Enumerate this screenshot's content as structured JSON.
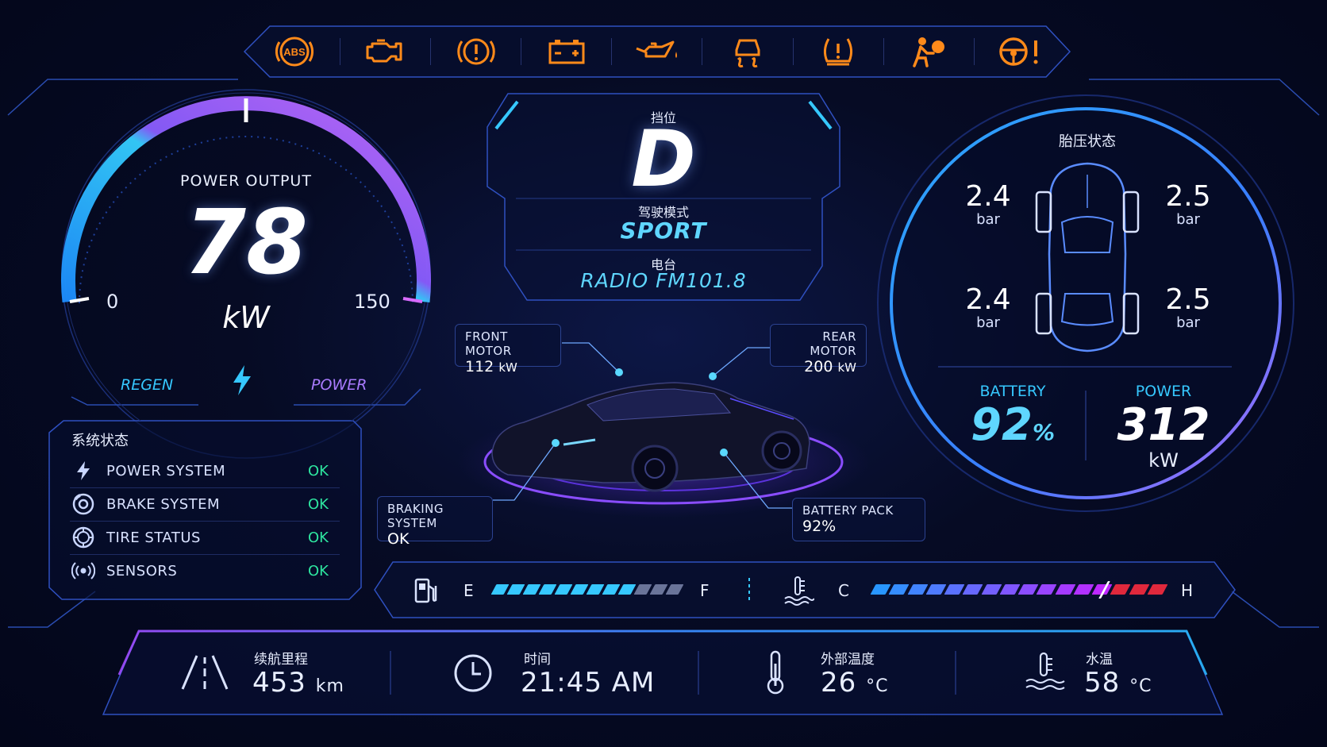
{
  "warnings": [
    {
      "icon": "abs-warning-icon",
      "label": "ABS"
    },
    {
      "icon": "check-engine-icon"
    },
    {
      "icon": "brake-warning-icon"
    },
    {
      "icon": "battery-warning-icon"
    },
    {
      "icon": "oil-pressure-icon"
    },
    {
      "icon": "traction-control-icon"
    },
    {
      "icon": "tire-pressure-warning-icon"
    },
    {
      "icon": "airbag-warning-icon"
    },
    {
      "icon": "steering-warning-icon"
    }
  ],
  "colors": {
    "warning": "#ff8a1a",
    "accent_blue": "#36c8ff",
    "accent_purple": "#a97bff",
    "ok": "#2ee6a0",
    "temp_hot": "#e0283c"
  },
  "power_gauge": {
    "title": "POWER OUTPUT",
    "value": "78",
    "unit": "kW",
    "min": "0",
    "max": "150",
    "regen_label": "REGEN",
    "power_label": "POWER",
    "level": 0.52
  },
  "system_status": {
    "title": "系统状态",
    "items": [
      {
        "icon": "lightning-icon",
        "name": "POWER SYSTEM",
        "status": "OK"
      },
      {
        "icon": "brake-disc-icon",
        "name": "BRAKE SYSTEM",
        "status": "OK"
      },
      {
        "icon": "tire-icon",
        "name": "TIRE STATUS",
        "status": "OK"
      },
      {
        "icon": "sensor-icon",
        "name": "SENSORS",
        "status": "OK"
      }
    ]
  },
  "center": {
    "gear_label": "挡位",
    "gear": "D",
    "mode_label": "驾驶模式",
    "mode": "SPORT",
    "radio_label": "电台",
    "radio": "RADIO  FM101.8"
  },
  "callouts": {
    "front_motor": {
      "title": "FRONT MOTOR",
      "value": "112",
      "unit": "kW"
    },
    "rear_motor": {
      "title": "REAR MOTOR",
      "value": "200",
      "unit": "kW"
    },
    "braking": {
      "title": "BRAKING SYSTEM",
      "value": "OK"
    },
    "battery_pack": {
      "title": "BATTERY PACK",
      "value": "92%"
    }
  },
  "tire_panel": {
    "title": "胎压状态",
    "front_left": {
      "pressure": "2.4",
      "unit": "bar"
    },
    "front_right": {
      "pressure": "2.5",
      "unit": "bar"
    },
    "rear_left": {
      "pressure": "2.4",
      "unit": "bar"
    },
    "rear_right": {
      "pressure": "2.5",
      "unit": "bar"
    },
    "battery_label": "BATTERY",
    "battery_value": "92",
    "battery_unit": "%",
    "power_label": "POWER",
    "power_value": "312",
    "power_unit": "kW"
  },
  "fuel": {
    "empty": "E",
    "full": "F",
    "level": 0.72
  },
  "coolant": {
    "cold": "C",
    "hot": "H",
    "level": 0.78
  },
  "bottom": {
    "range": {
      "label": "续航里程",
      "value": "453",
      "unit": "km"
    },
    "time": {
      "label": "时间",
      "value": "21:45 AM"
    },
    "outside_temp": {
      "label": "外部温度",
      "value": "26",
      "unit": "°C"
    },
    "water_temp": {
      "label": "水温",
      "value": "58",
      "unit": "°C"
    }
  }
}
